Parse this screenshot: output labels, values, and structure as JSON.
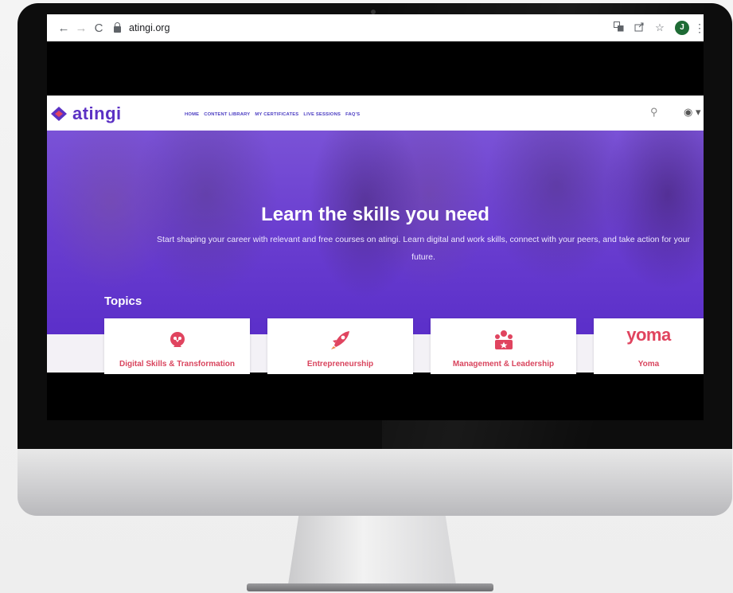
{
  "browser": {
    "url": "atingi.org",
    "profile_initial": "J"
  },
  "site": {
    "logo_text": "atingi",
    "nav": [
      "HOME",
      "CONTENT LIBRARY",
      "MY CERTIFICATES",
      "LIVE SESSIONS",
      "FAQ'S"
    ]
  },
  "hero": {
    "title": "Learn the skills you need",
    "subtitle": "Start shaping your career with relevant and free courses on atingi. Learn digital and work skills, connect with your peers, and take action for your future."
  },
  "topics": {
    "heading": "Topics",
    "cards": [
      {
        "label": "Digital Skills & Transformation",
        "icon": "digital-skills-icon"
      },
      {
        "label": "Entrepreneurship",
        "icon": "rocket-icon"
      },
      {
        "label": "Management & Leadership",
        "icon": "team-icon"
      },
      {
        "label": "Yoma",
        "logo": "yoma"
      }
    ]
  },
  "colors": {
    "brand_purple": "#5b31c4",
    "hero_purple": "#6a3ed0",
    "topic_red": "#d9455e"
  }
}
